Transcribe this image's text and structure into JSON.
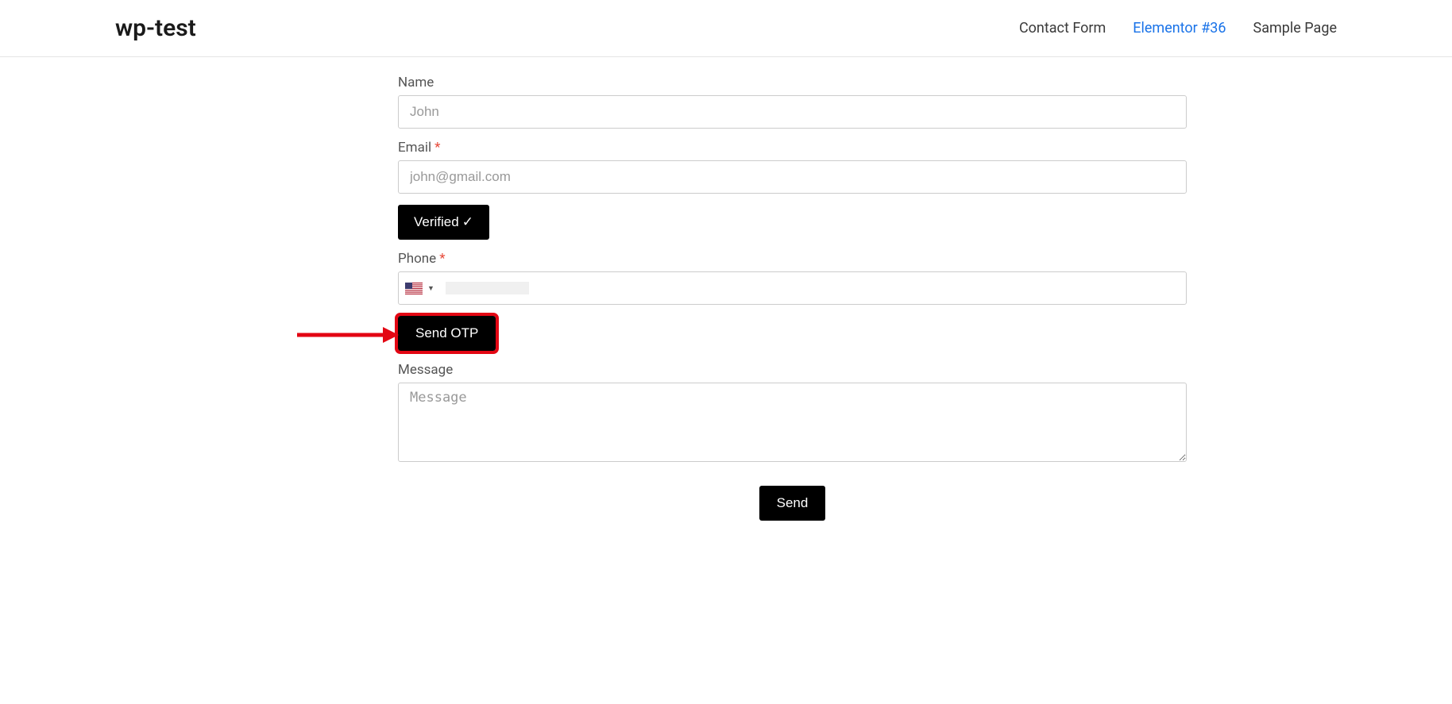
{
  "header": {
    "site_title": "wp-test",
    "nav": [
      {
        "label": "Contact Form",
        "active": false
      },
      {
        "label": "Elementor #36",
        "active": true
      },
      {
        "label": "Sample Page",
        "active": false
      }
    ]
  },
  "form": {
    "name": {
      "label": "Name",
      "required": false,
      "value": "",
      "placeholder": "John"
    },
    "email": {
      "label": "Email",
      "required": true,
      "value": "",
      "placeholder": "john@gmail.com"
    },
    "verified_button_label": "Verified",
    "verified_check": "✓",
    "phone": {
      "label": "Phone",
      "required": true,
      "country_code": "US",
      "value": ""
    },
    "send_otp_label": "Send OTP",
    "message": {
      "label": "Message",
      "required": false,
      "value": "",
      "placeholder": "Message"
    },
    "send_label": "Send"
  },
  "annotations": {
    "arrow_color": "#e30613",
    "highlight_target": "send-otp-button"
  },
  "required_marker": "*"
}
